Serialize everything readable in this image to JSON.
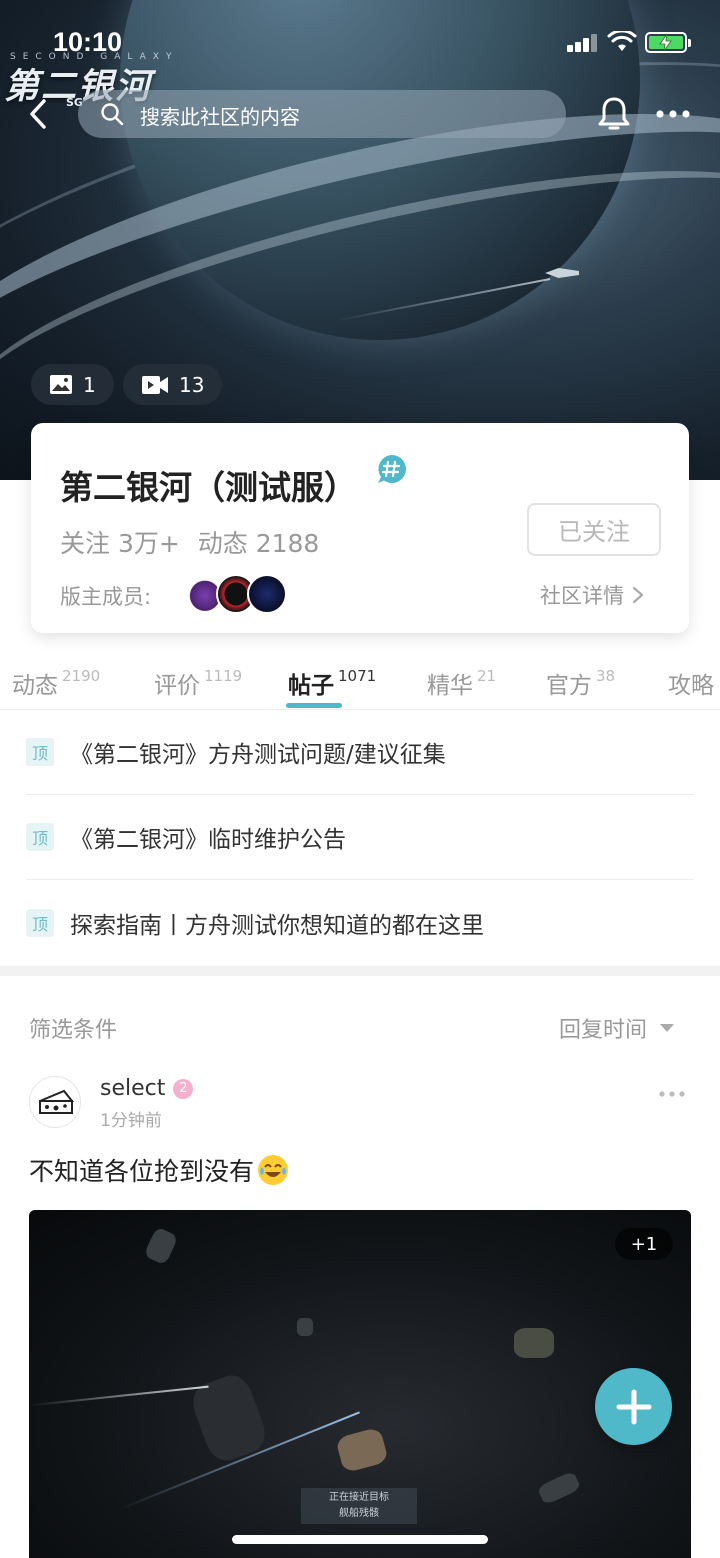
{
  "status_bar": {
    "time": "10:10"
  },
  "hero": {
    "game_logo": {
      "sub": "SECOND GALAXY",
      "main": "第二银河",
      "mark": "SG"
    },
    "search_placeholder": "搜索此社区的内容",
    "photo_count": "1",
    "video_count": "13"
  },
  "community": {
    "title": "第二银河（测试服）",
    "followers": "关注 3万+",
    "posts": "动态 2188",
    "follow_button": "已关注",
    "moderators_label": "版主成员:",
    "details_link": "社区详情"
  },
  "tabs": [
    {
      "label": "动态",
      "count": "2190"
    },
    {
      "label": "评价",
      "count": "1119"
    },
    {
      "label": "帖子",
      "count": "1071",
      "active": true
    },
    {
      "label": "精华",
      "count": "21"
    },
    {
      "label": "官方",
      "count": "38"
    },
    {
      "label": "攻略",
      "count": ""
    }
  ],
  "pinned": {
    "tag": "顶",
    "items": [
      "《第二银河》方舟测试问题/建议征集",
      "《第二银河》临时维护公告",
      "探索指南丨方舟测试你想知道的都在这里"
    ]
  },
  "filter": {
    "label": "筛选条件",
    "sort": "回复时间"
  },
  "post": {
    "user": "select",
    "level": "2",
    "time": "1分钟前",
    "text": "不知道各位抢到没有",
    "image_count": "+1",
    "hud_line1": "正在接近目标",
    "hud_line2": "舰船残骸"
  },
  "colors": {
    "accent": "#4fb8c9",
    "level_badge": "#f3b1cf"
  }
}
